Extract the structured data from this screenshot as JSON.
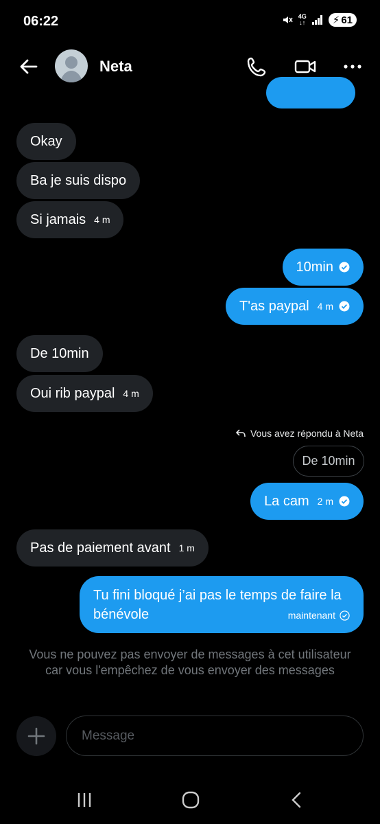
{
  "status": {
    "time": "06:22",
    "network": "4G",
    "battery": "61"
  },
  "header": {
    "contact_name": "Neta"
  },
  "messages": [
    {
      "dir": "in",
      "text": "Okay",
      "time": ""
    },
    {
      "dir": "in",
      "text": "Ba je suis dispo",
      "time": ""
    },
    {
      "dir": "in",
      "text": "Si jamais",
      "time": "4 m"
    },
    {
      "dir": "out",
      "text": "10min",
      "time": ""
    },
    {
      "dir": "out",
      "text": "T'as paypal",
      "time": "4 m"
    },
    {
      "dir": "in",
      "text": "De 10min",
      "time": ""
    },
    {
      "dir": "in",
      "text": "Oui rib paypal",
      "time": "4 m"
    },
    {
      "dir": "out",
      "text": "La cam",
      "time": "2 m"
    },
    {
      "dir": "in",
      "text": "Pas de paiement avant",
      "time": "1 m"
    }
  ],
  "reply": {
    "note": "Vous avez répondu à Neta",
    "quoted": "De 10min"
  },
  "last_message": {
    "text": "Tu fini bloqué j’ai pas le temps de faire la bénévole",
    "time": "maintenant"
  },
  "blocked_notice": "Vous ne pouvez pas envoyer de messages à cet utilisateur car vous l'empêchez de vous envoyer des messages",
  "composer": {
    "placeholder": "Message"
  },
  "colors": {
    "outgoing": "#1d9bf0",
    "incoming": "#202327",
    "background": "#000000"
  },
  "icons": [
    "back-arrow-icon",
    "phone-icon",
    "video-icon",
    "more-icon",
    "plus-icon",
    "reply-icon",
    "check-icon"
  ]
}
